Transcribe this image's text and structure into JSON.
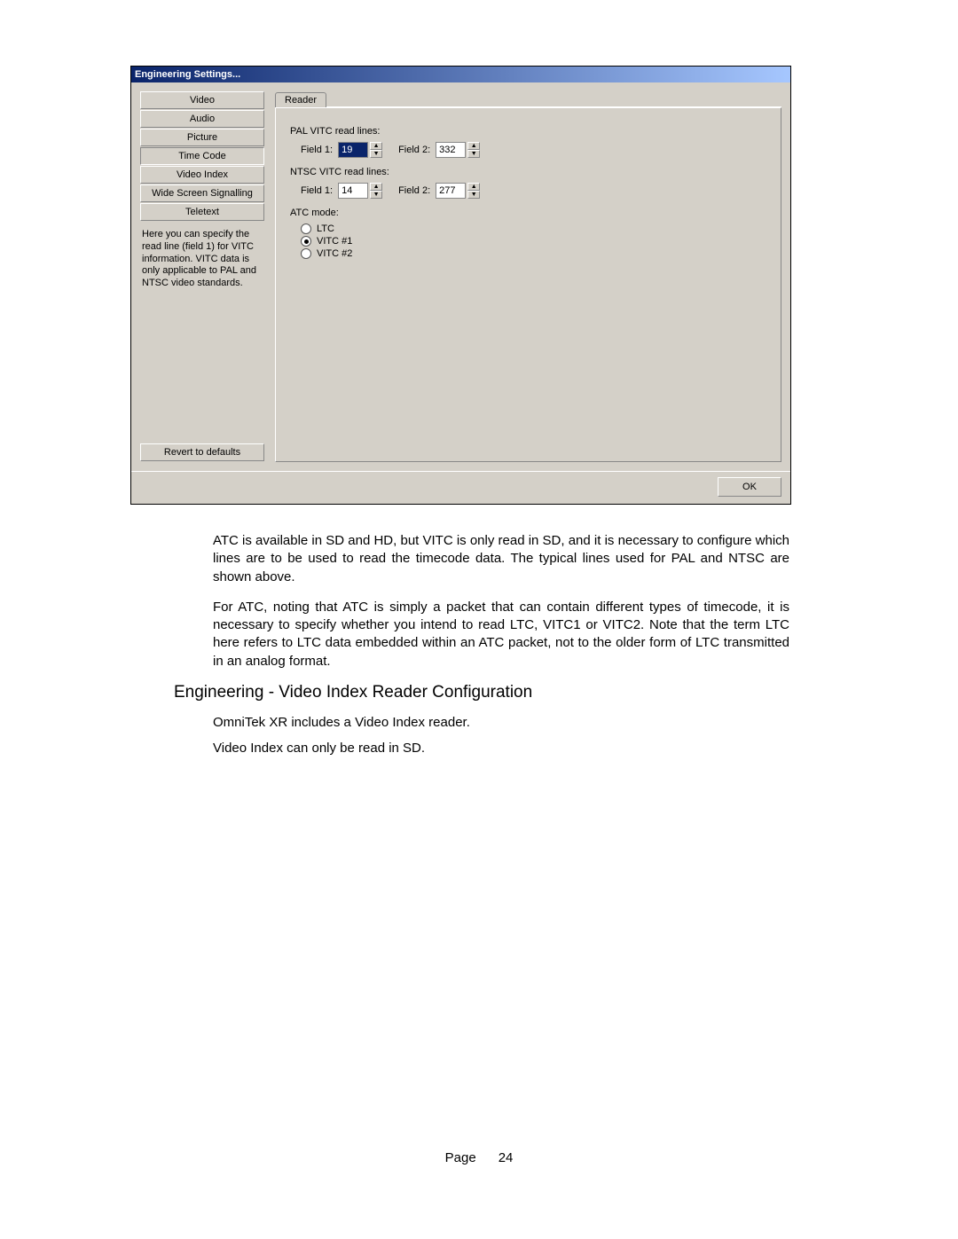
{
  "dialog": {
    "title": "Engineering Settings...",
    "sidebar": {
      "items": [
        "Video",
        "Audio",
        "Picture",
        "Time Code",
        "Video Index",
        "Wide Screen Signalling",
        "Teletext"
      ],
      "help": "Here you can specify the read line (field 1) for VITC information.  VITC data is only applicable to PAL and NTSC video standards.",
      "revert": "Revert to defaults"
    },
    "tab": "Reader",
    "pal_label": "PAL VITC read lines:",
    "ntsc_label": "NTSC VITC read lines:",
    "field1_label": "Field 1:",
    "field2_label": "Field 2:",
    "pal": {
      "f1": "19",
      "f2": "332"
    },
    "ntsc": {
      "f1": "14",
      "f2": "277"
    },
    "atc": {
      "label": "ATC mode:",
      "options": [
        "LTC",
        "VITC #1",
        "VITC #2"
      ],
      "selected": 1
    },
    "ok": "OK"
  },
  "body": {
    "p1": "ATC is available in SD and HD, but VITC is only read in SD, and it is necessary to configure which lines are to be used to read the timecode data.  The typical lines used for PAL and NTSC are shown above.",
    "p2": "For ATC, noting that ATC is simply a packet that can contain different types of timecode, it is necessary to specify whether you intend to read LTC, VITC1 or VITC2.  Note that the term LTC here refers to LTC data embedded within an ATC packet, not to the older form of LTC transmitted in an analog format.",
    "heading": "Engineering - Video Index Reader Configuration",
    "p3": "OmniTek XR includes a Video Index reader.",
    "p4": "Video Index can only be read in SD.",
    "page_label": "Page",
    "page_num": "24"
  }
}
